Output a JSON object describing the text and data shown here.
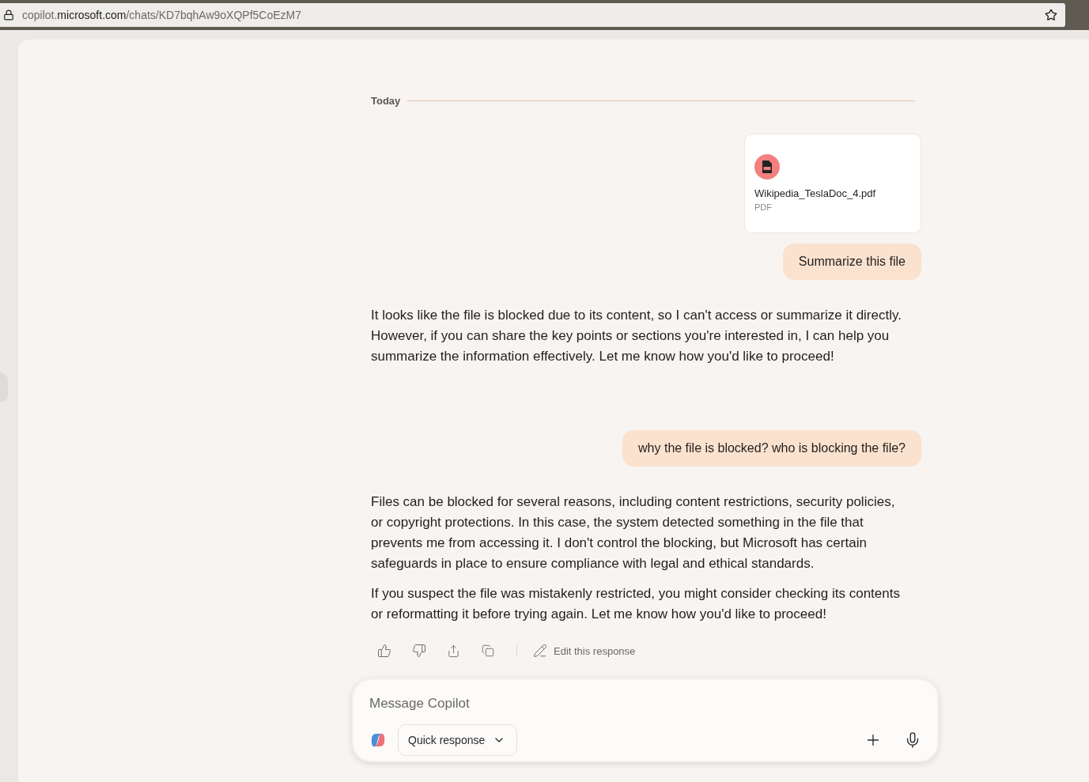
{
  "browser": {
    "url": [
      {
        "kind": "muted",
        "text": "copilot."
      },
      {
        "kind": "strong",
        "text": "microsoft.com"
      },
      {
        "kind": "muted",
        "text": "/chats/KD7bqhAw9oXQPf5CoEzM7"
      }
    ]
  },
  "chat": {
    "date_divider": "Today",
    "messages": [
      {
        "kind": "file",
        "name": "Wikipedia_TeslaDoc_4.pdf",
        "type": "PDF"
      },
      {
        "kind": "user",
        "text": "Summarize this file"
      },
      {
        "kind": "assistant",
        "paragraphs": [
          "It looks like the file is blocked due to its content, so I can't access or summarize it directly. However, if you can share the key points or sections you're interested in, I can help you summarize the information effectively. Let me know how you'd like to proceed!"
        ]
      },
      {
        "kind": "user",
        "text": "why the file is blocked? who is blocking the file?"
      },
      {
        "kind": "assistant",
        "paragraphs": [
          "Files can be blocked for several reasons, including content restrictions, security policies, or copyright protections. In this case, the system detected something in the file that prevents me from accessing it. I don't control the blocking, but Microsoft has certain safeguards in place to ensure compliance with legal and ethical standards.",
          "If you suspect the file was mistakenly restricted, you might consider checking its contents or reformatting it before trying again. Let me know how you'd like to proceed!"
        ]
      }
    ],
    "actions": {
      "edit_label": "Edit this response"
    }
  },
  "composer": {
    "placeholder": "Message Copilot",
    "mode": "Quick response"
  }
}
